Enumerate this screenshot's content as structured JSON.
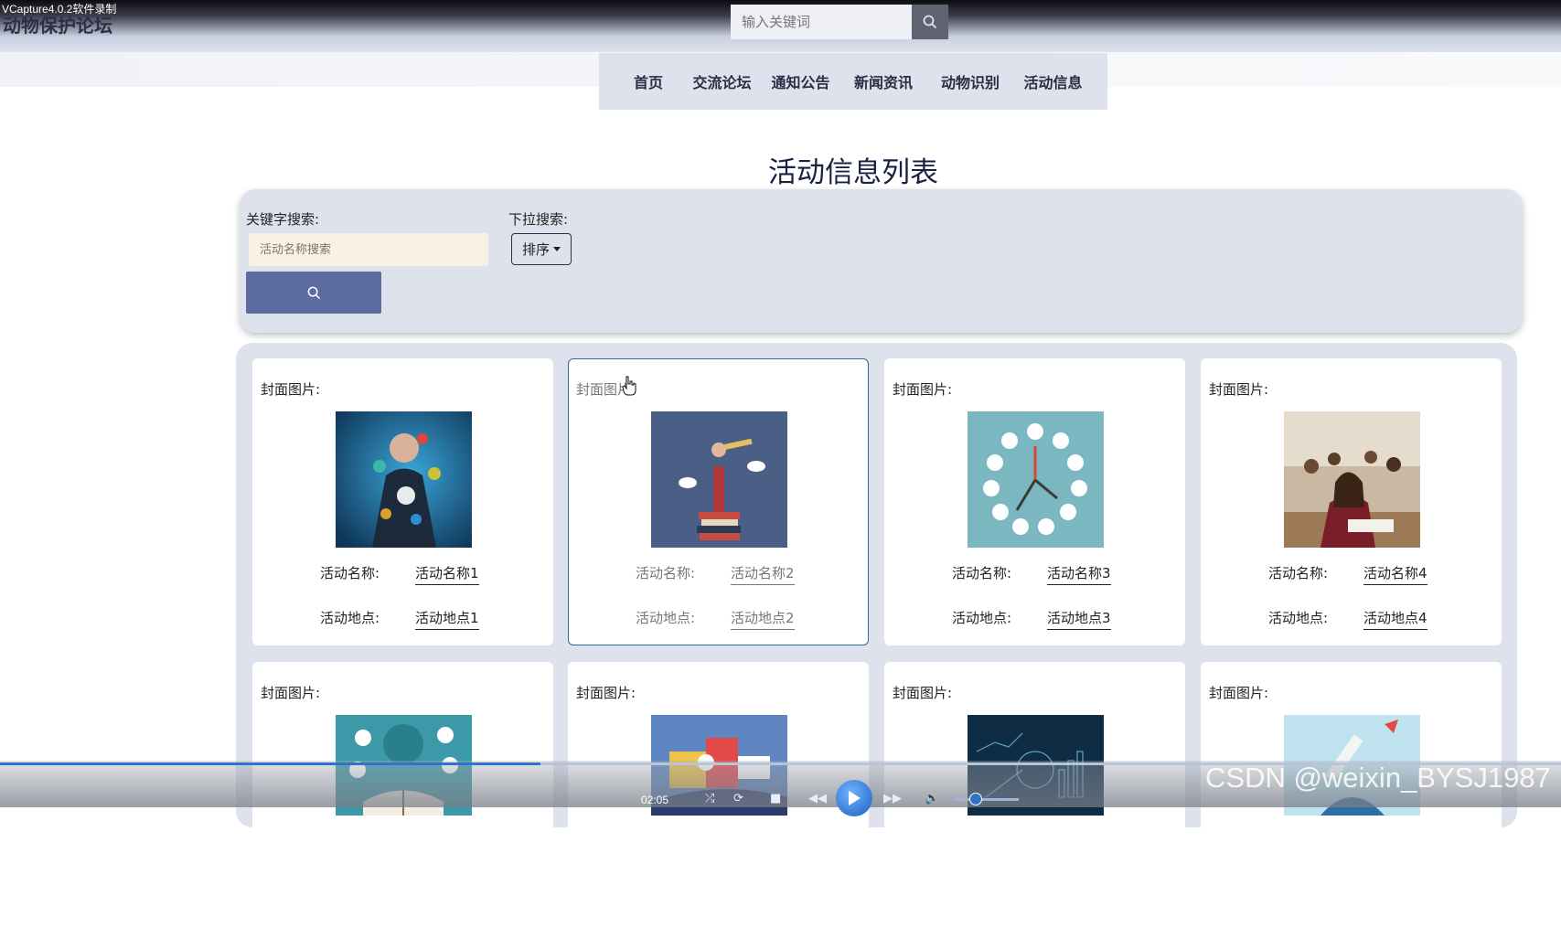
{
  "recorder": {
    "watermark": "VCapture4.0.2软件录制"
  },
  "header": {
    "site_title": "动物保护论坛",
    "search_placeholder": "输入关键词"
  },
  "nav": {
    "items": [
      "首页",
      "交流论坛",
      "通知公告",
      "新闻资讯",
      "动物识别",
      "活动信息"
    ]
  },
  "page": {
    "title": "活动信息列表"
  },
  "filters": {
    "keyword_label": "关键字搜索:",
    "keyword_placeholder": "活动名称搜索",
    "dropdown_label": "下拉搜索:",
    "sort_label": "排序"
  },
  "cards": [
    {
      "cover_label": "封面图片:",
      "name_label": "活动名称:",
      "name": "活动名称1",
      "location_label": "活动地点:",
      "location": "活动地点1",
      "image": "business-person-education-icons"
    },
    {
      "cover_label": "封面图片:",
      "name_label": "活动名称:",
      "name": "活动名称2",
      "location_label": "活动地点:",
      "location": "活动地点2",
      "image": "person-with-telescope-on-books"
    },
    {
      "cover_label": "封面图片:",
      "name_label": "活动名称:",
      "name": "活动名称3",
      "location_label": "活动地点:",
      "location": "活动地点3",
      "image": "clock-with-icons"
    },
    {
      "cover_label": "封面图片:",
      "name_label": "活动名称:",
      "name": "活动名称4",
      "location_label": "活动地点:",
      "location": "活动地点4",
      "image": "students-in-classroom"
    },
    {
      "cover_label": "封面图片:",
      "image": "online-education"
    },
    {
      "cover_label": "封面图片:",
      "image": "study-at-home-every-day"
    },
    {
      "cover_label": "封面图片:",
      "image": "dark-blue-business-charts"
    },
    {
      "cover_label": "封面图片:",
      "image": "rocket-win"
    }
  ],
  "player": {
    "time": "02:05",
    "progress": 0.346
  },
  "overlay": {
    "csdn_watermark": "CSDN @weixin_BYSJ1987"
  },
  "colors": {
    "nav_bg": "#dde2ec",
    "panel_bg": "#dde2ec",
    "search_button": "#5c6ba0",
    "keyword_input_bg": "#faf1e4",
    "title": "#1b2144"
  }
}
